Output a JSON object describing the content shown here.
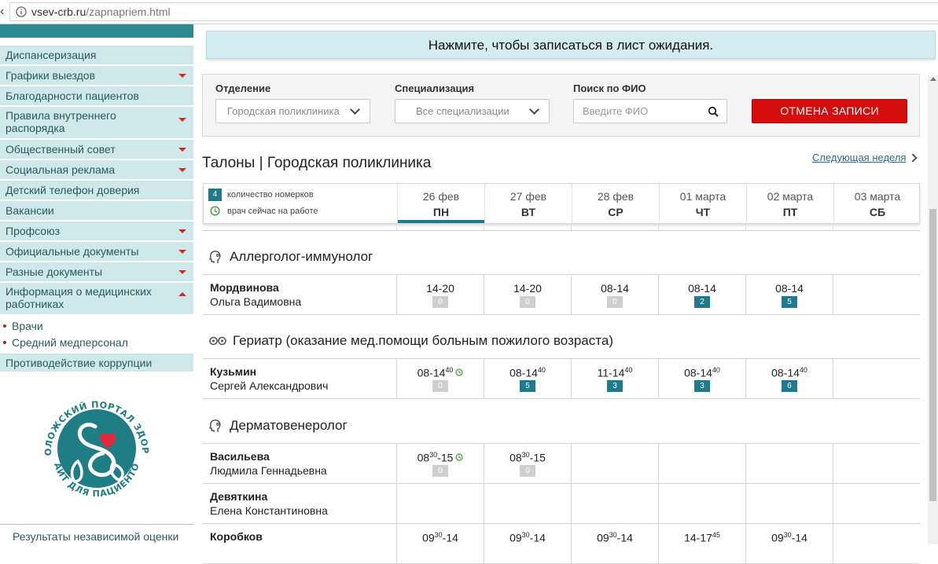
{
  "browser": {
    "url_domain": "vsev-crb.ru",
    "url_path": "/zapnapriem.html"
  },
  "sidebar": {
    "items": [
      "Диспансеризация",
      "Графики выездов",
      "Благодарности пациентов",
      "Правила внутреннего распорядка",
      "Общественный совет",
      "Социальная реклама",
      "Детский телефон доверия",
      "Вакансии",
      "Профсоюз",
      "Официальные документы",
      "Разные документы",
      "Информация о медицинских работниках"
    ],
    "subitems": [
      "Врачи",
      "Средний медперсонал"
    ],
    "after": "Противодействие коррупции",
    "logo_text_top": "ВСЕВОЛОЖСКИЙ ПОРТАЛ ЗДОРОВЬЯ",
    "logo_text_bottom": "САЙТ ДЛЯ ПАЦИЕНТОВ",
    "bottom_link": "Результаты независимой оценки",
    "accent": "#2c8a93"
  },
  "waitlist_banner": "Нажмите, чтобы записаться в лист ожидания.",
  "filters": {
    "department_label": "Отделение",
    "department_value": "Городская поликлиника",
    "specialization_label": "Специализация",
    "specialization_value": "Все специализации",
    "search_label": "Поиск по ФИО",
    "search_placeholder": "Введите ФИО",
    "cancel_button": "ОТМЕНА ЗАПИСИ"
  },
  "title": "Талоны | Городская поликлиника",
  "next_week": "Следующая неделя",
  "legend": {
    "badge": "4",
    "count_text": "количество номерков",
    "working_text": "врач сейчас на работе"
  },
  "days": [
    {
      "date": "26 фев",
      "weekday": "ПН"
    },
    {
      "date": "27 фев",
      "weekday": "ВТ"
    },
    {
      "date": "28 фев",
      "weekday": "СР"
    },
    {
      "date": "01 марта",
      "weekday": "ЧТ"
    },
    {
      "date": "02 марта",
      "weekday": "ПТ"
    },
    {
      "date": "03 марта",
      "weekday": "СБ"
    }
  ],
  "sections": [
    {
      "name": "Аллерголог-иммунолог",
      "doctors": [
        {
          "last": "Мордвинова",
          "first": "Ольга Вадимовна",
          "slots": [
            {
              "a": "14-20",
              "b": "",
              "c": "",
              "count": "0"
            },
            {
              "a": "14-20",
              "b": "",
              "c": "",
              "count": "0"
            },
            {
              "a": "08-14",
              "b": "",
              "c": "",
              "count": "0"
            },
            {
              "a": "08-14",
              "b": "",
              "c": "",
              "count": "2"
            },
            {
              "a": "08-14",
              "b": "",
              "c": "",
              "count": "5"
            },
            null
          ]
        }
      ]
    },
    {
      "name": "Гериатр (оказание мед.помощи больным пожилого возраста)",
      "doctors": [
        {
          "last": "Кузьмин",
          "first": "Сергей Александрович",
          "slots": [
            {
              "a": "08-14",
              "b": "40",
              "c": "",
              "count": "0",
              "working": true
            },
            {
              "a": "08-14",
              "b": "40",
              "c": "",
              "count": "5"
            },
            {
              "a": "11-14",
              "b": "40",
              "c": "",
              "count": "3"
            },
            {
              "a": "08-14",
              "b": "40",
              "c": "",
              "count": "3"
            },
            {
              "a": "08-14",
              "b": "40",
              "c": "",
              "count": "6"
            },
            null
          ]
        }
      ]
    },
    {
      "name": "Дерматовенеролог",
      "doctors": [
        {
          "last": "Васильева",
          "first": "Людмила Геннадьевна",
          "slots": [
            {
              "a": "08",
              "b": "30",
              "c": "-15",
              "count": "0",
              "working": true
            },
            {
              "a": "08",
              "b": "30",
              "c": "-15",
              "count": "0"
            },
            null,
            null,
            null,
            null
          ]
        },
        {
          "last": "Девяткина",
          "first": "Елена Константиновна",
          "slots": [
            null,
            null,
            null,
            null,
            null,
            null
          ]
        },
        {
          "last": "Коробков",
          "first": "",
          "slots": [
            {
              "a": "09",
              "b": "30",
              "c": "-14",
              "count": ""
            },
            {
              "a": "09",
              "b": "30",
              "c": "-14",
              "count": ""
            },
            {
              "a": "09",
              "b": "30",
              "c": "-14",
              "count": ""
            },
            {
              "a": "14-17",
              "b": "45",
              "c": "",
              "count": ""
            },
            {
              "a": "09",
              "b": "30",
              "c": "-14",
              "count": ""
            },
            null
          ]
        }
      ]
    }
  ]
}
